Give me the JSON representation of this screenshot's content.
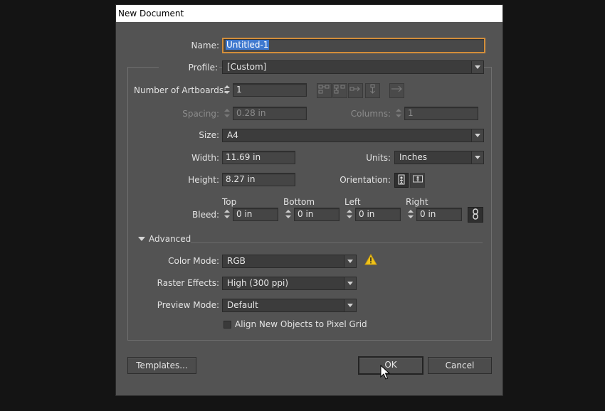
{
  "window": {
    "title": "New Document"
  },
  "name": {
    "label": "Name:",
    "value": "Untitled-1"
  },
  "profile": {
    "label": "Profile:",
    "value": "[Custom]"
  },
  "artboards": {
    "label": "Number of Artboards:",
    "value": "1"
  },
  "spacing": {
    "label": "Spacing:",
    "value": "0.28 in"
  },
  "columns": {
    "label": "Columns:",
    "value": "1"
  },
  "size": {
    "label": "Size:",
    "value": "A4"
  },
  "width": {
    "label": "Width:",
    "value": "11.69 in"
  },
  "units": {
    "label": "Units:",
    "value": "Inches"
  },
  "height": {
    "label": "Height:",
    "value": "8.27 in"
  },
  "orientation": {
    "label": "Orientation:",
    "selected": "portrait"
  },
  "bleed": {
    "label": "Bleed:",
    "top": {
      "label": "Top",
      "value": "0 in"
    },
    "bottom": {
      "label": "Bottom",
      "value": "0 in"
    },
    "left": {
      "label": "Left",
      "value": "0 in"
    },
    "right": {
      "label": "Right",
      "value": "0 in"
    }
  },
  "advanced": {
    "label": "Advanced",
    "expanded": true
  },
  "color_mode": {
    "label": "Color Mode:",
    "value": "RGB",
    "warning_icon": "warning-triangle-icon"
  },
  "raster_effects": {
    "label": "Raster Effects:",
    "value": "High (300 ppi)"
  },
  "preview_mode": {
    "label": "Preview Mode:",
    "value": "Default"
  },
  "align_pixel_grid": {
    "label": "Align New Objects to Pixel Grid",
    "checked": false
  },
  "buttons": {
    "templates": "Templates...",
    "ok": "OK",
    "cancel": "Cancel"
  },
  "colors": {
    "dialog_bg": "#535353",
    "field_bg": "#454545",
    "focus_border": "#d38e3a",
    "selection": "#3f79cf",
    "warning": "#f0c419"
  }
}
